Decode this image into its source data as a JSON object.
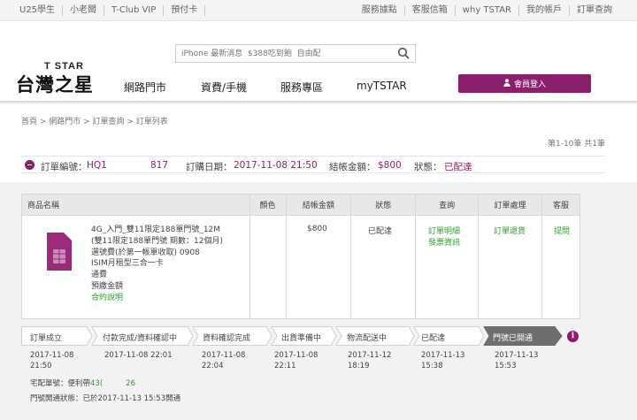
{
  "topbar": {
    "left": [
      "U25學生",
      "小老闆",
      "T-Club VIP",
      "預付卡"
    ],
    "right": [
      "服務據點",
      "客服信箱",
      "why TSTAR",
      "我的帳戶",
      "訂單查詢"
    ]
  },
  "search": {
    "placeholder": "iPhone 最新消息  $388吃到飽  自由配"
  },
  "logo": {
    "small": "T STAR",
    "big": "台灣之星"
  },
  "nav": [
    "網路門市",
    "資費/手機",
    "服務專區",
    "myTSTAR"
  ],
  "login": {
    "label": "會員登入"
  },
  "breadcrumb": "首頁 > 網路門市 > 訂單查詢 > 訂單列表",
  "page_info": "第1-10筆 共1筆",
  "order": {
    "no_label": "訂單編號：",
    "no_prefix": "HQ1",
    "no_suffix": "817",
    "date_label": "訂購日期：",
    "date": "2017-11-08 21:50",
    "amount_label": "結帳金額：",
    "amount": "$800",
    "status_label": "狀態：",
    "status": "已配達"
  },
  "table": {
    "headers": [
      "商品名稱",
      "顏色",
      "結帳金額",
      "狀態",
      "查詢",
      "訂單處理",
      "客服"
    ],
    "product_lines": [
      "4G_入門_雙11限定188單門號_12M",
      "(雙11限定188單門號 期數：12個月)",
      "選號費(於第一帳單收取) 0908",
      "ISIM月租型三合一卡",
      "通費",
      "預繳金額"
    ],
    "contract_link": "合約說明",
    "amount": "$800",
    "status": "已配達",
    "query_links": [
      "訂單明細",
      "發票資訊"
    ],
    "process_link": "訂單退貨",
    "service_link": "提問"
  },
  "steps": [
    {
      "label": "訂單成立",
      "date": "2017-11-08",
      "time": "21:50"
    },
    {
      "label": "付款完成/資料確認中",
      "date": "2017-11-08 22:01",
      "time": ""
    },
    {
      "label": "資料確認完成",
      "date": "2017-11-08",
      "time": "22:04"
    },
    {
      "label": "出貨準備中",
      "date": "2017-11-08",
      "time": "22:11"
    },
    {
      "label": "物流配送中",
      "date": "2017-11-12",
      "time": "18:19"
    },
    {
      "label": "已配達",
      "date": "2017-11-13",
      "time": "15:38"
    },
    {
      "label": "門號已開通",
      "date": "2017-11-13",
      "time": "15:53"
    }
  ],
  "delivery": {
    "label": "宅配單號：便利帶",
    "num_a": "43(",
    "num_b": "26"
  },
  "activation": "門號開通狀態：已於2017-11-13 15:53開通",
  "colors": {
    "brand": "#8b1f6b",
    "link_green": "#2aa22a"
  }
}
